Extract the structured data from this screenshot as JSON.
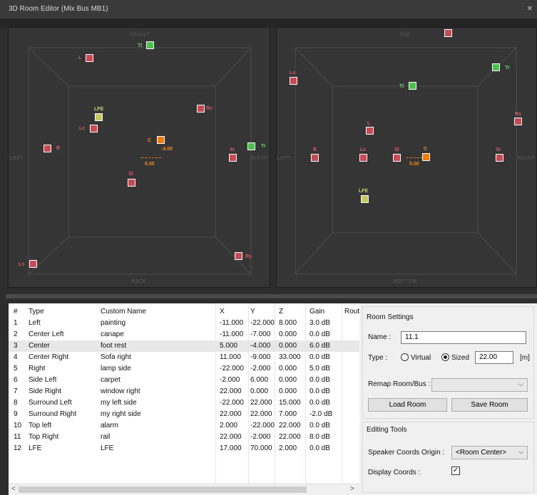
{
  "window": {
    "title": "3D Room Editor (Mix Bus MB1)",
    "close": "✕"
  },
  "view_left": {
    "front": "FRONT",
    "back": "BACK",
    "left": "LEFT",
    "right": "RIGHT",
    "speakers": {
      "L": "L",
      "Tl": "Tl",
      "LFE": "LFE",
      "Lc": "Lc",
      "Rc": "Rc",
      "C": "C",
      "R": "R",
      "Sr": "Sr",
      "Tr": "Tr",
      "Sl": "Sl",
      "Ls": "Ls",
      "Rs": "Rs"
    },
    "coord_x": "-4.00",
    "coord_y": "5.00"
  },
  "view_right": {
    "top": "TOP",
    "bottom": "BOTTOM",
    "left": "LEFT",
    "right": "RIGHT",
    "speakers": {
      "Ls": "Ls",
      "Tr": "Tr",
      "Tl": "Tl",
      "Rs": "Rs",
      "L": "L",
      "R": "R",
      "Lc": "Lc",
      "Sl": "Sl",
      "C": "C",
      "Sr": "Sr",
      "LFE": "LFE"
    },
    "coord_x": "5.00"
  },
  "table": {
    "headers": [
      "#",
      "Type",
      "Custom Name",
      "X",
      "Y",
      "Z",
      "Gain",
      "Rout"
    ],
    "rows": [
      [
        "1",
        "Left",
        "painting",
        "-11.000",
        "-22.000",
        "8.000",
        "3.0 dB"
      ],
      [
        "2",
        "Center Left",
        "canape",
        "-11.000",
        "-7.000",
        "0.000",
        "0.0 dB"
      ],
      [
        "3",
        "Center",
        "foot rest",
        "5.000",
        "-4.000",
        "0.000",
        "6.0 dB"
      ],
      [
        "4",
        "Center Right",
        "Sofa right",
        "11.000",
        "-9.000",
        "33.000",
        "0.0 dB"
      ],
      [
        "5",
        "Right",
        "lamp side",
        "-22.000",
        "-2.000",
        "0.000",
        "5.0 dB"
      ],
      [
        "6",
        "Side Left",
        "carpet",
        "-2.000",
        "6.000",
        "0.000",
        "0.0 dB"
      ],
      [
        "7",
        "Side Right",
        "window right",
        "22.000",
        "0.000",
        "0.000",
        "0.0 dB"
      ],
      [
        "8",
        "Surround Left",
        "my left side",
        "-22.000",
        "22.000",
        "15.000",
        "0.0 dB"
      ],
      [
        "9",
        "Surround Right",
        "my right side",
        "22.000",
        "22.000",
        "7.000",
        "-2.0 dB"
      ],
      [
        "10",
        "Top left",
        "alarm",
        "2.000",
        "-22.000",
        "22.000",
        "0.0 dB"
      ],
      [
        "11",
        "Top Right",
        "rail",
        "22.000",
        "-2.000",
        "22.000",
        "8.0 dB"
      ],
      [
        "12",
        "LFE",
        "LFE",
        "17.000",
        "70.000",
        "2.000",
        "0.0 dB"
      ]
    ],
    "selected_row": 3,
    "scroll_left": "<",
    "scroll_right": ">"
  },
  "room_settings": {
    "title": "Room Settings",
    "name_label": "Name :",
    "name_value": "11.1",
    "type_label": "Type :",
    "virtual_label": "Virtual",
    "sized_label": "Sized",
    "sized_selected": true,
    "size_value": "22.00",
    "unit": "[m]",
    "remap_label": "Remap Room/Bus :",
    "remap_value": "",
    "load_button": "Load Room",
    "save_button": "Save Room"
  },
  "editing_tools": {
    "title": "Editing Tools",
    "origin_label": "Speaker Coords Origin :",
    "origin_value": "<Room Center>",
    "display_label": "Display Coords :",
    "display_checked": "✓"
  },
  "colors": {
    "surround": "#c84a55",
    "top": "#4cbf4c",
    "lfe": "#c8c860",
    "selected": "#f07b0a",
    "viewport": "#353535"
  }
}
